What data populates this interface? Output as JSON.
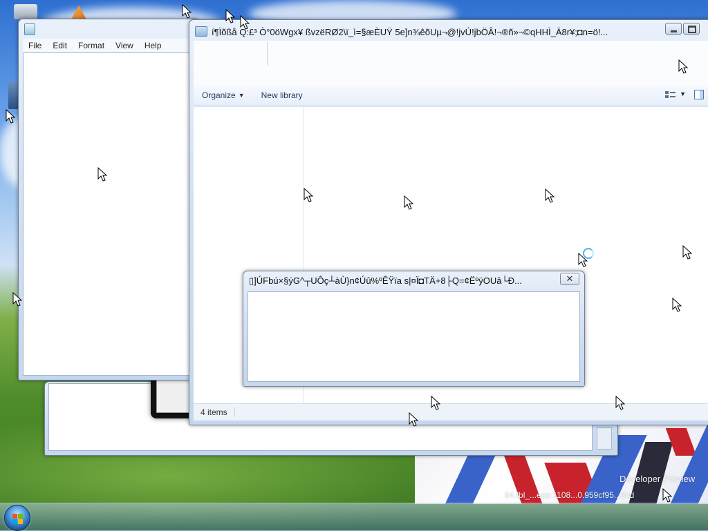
{
  "notepad": {
    "menu": [
      "File",
      "Edit",
      "Format",
      "View",
      "Help"
    ]
  },
  "explorer": {
    "title": "í¶Ïõßå Q:£³ Ò°0öWgx¥    ßvzëRØ2\\ï_ì=§æÈUŸ    5e]n¾êõUµ¬@!jvÚ!jbÖÂ!¬®ñ»¬©qHHÌ_Ä8r¥;◘n=ö!...",
    "toolbar": {
      "organize": "Organize",
      "new_library": "New library"
    },
    "status": "4 items"
  },
  "dialog": {
    "title": "▯]ÚFbú×§ýG^┬UÔç┴àÙ}n¢Úû%ºÊŸïa    s|¤Ï◘TÄ+8├Q=¢ËºÿOUâ└Ð...",
    "close": "✕"
  },
  "desktop": {
    "watermark_line1": "Developer Preview",
    "watermark_line2": "64.fbl_...eap.1108...0.959cf95...6cd"
  },
  "colors": {
    "accent": "#3d8fd6",
    "glass_frame": "#c5d7ee",
    "toolbar_text": "#1e395b"
  },
  "icons": [
    "start-orb-icon",
    "notepad-icon",
    "library-folder-icon",
    "view-options-icon",
    "preview-pane-icon",
    "close-icon",
    "arrow-cursor-icon"
  ]
}
